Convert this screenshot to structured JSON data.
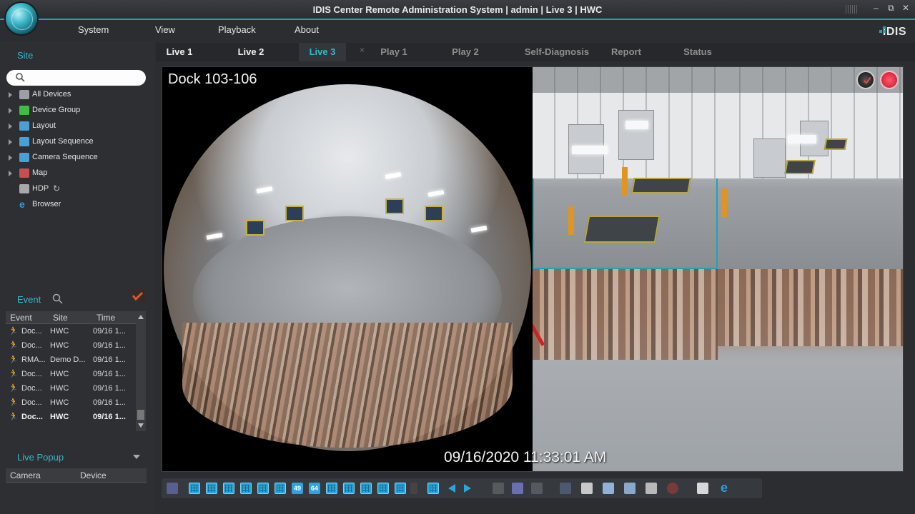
{
  "window": {
    "title": "IDIS Center Remote Administration System | admin | Live 3 | HWC",
    "brand": "IDIS",
    "accent": "#1fa3b5"
  },
  "menu": {
    "items": [
      "System",
      "View",
      "Playback",
      "About"
    ]
  },
  "site": {
    "title": "Site",
    "search_placeholder": "",
    "tree": [
      {
        "label": "All Devices",
        "icon": "all-devices-icon",
        "color": "#9aa0a6"
      },
      {
        "label": "Device Group",
        "icon": "device-group-icon",
        "color": "#3fbf3f"
      },
      {
        "label": "Layout",
        "icon": "layout-icon",
        "color": "#4a9fd6"
      },
      {
        "label": "Layout Sequence",
        "icon": "layout-sequence-icon",
        "color": "#4a9fd6"
      },
      {
        "label": "Camera Sequence",
        "icon": "camera-sequence-icon",
        "color": "#4a9fd6"
      },
      {
        "label": "Map",
        "icon": "map-icon",
        "color": "#c65050"
      },
      {
        "label": "HDP",
        "icon": "hdp-icon",
        "color": "#a8a8a8"
      },
      {
        "label": "Browser",
        "icon": "browser-icon",
        "color": "#2a9ee0"
      }
    ]
  },
  "event": {
    "title": "Event",
    "columns": [
      "Event",
      "Site",
      "Time"
    ],
    "rows": [
      {
        "event": "Doc...",
        "site": "HWC",
        "time": "09/16 1..."
      },
      {
        "event": "Doc...",
        "site": "HWC",
        "time": "09/16 1..."
      },
      {
        "event": "RMA...",
        "site": "Demo D...",
        "time": "09/16 1..."
      },
      {
        "event": "Doc...",
        "site": "HWC",
        "time": "09/16 1..."
      },
      {
        "event": "Doc...",
        "site": "HWC",
        "time": "09/16 1..."
      },
      {
        "event": "Doc...",
        "site": "HWC",
        "time": "09/16 1..."
      },
      {
        "event": "Doc...",
        "site": "HWC",
        "time": "09/16 1...",
        "bold": true
      }
    ]
  },
  "live_popup": {
    "title": "Live Popup",
    "columns": [
      "Camera",
      "Device"
    ]
  },
  "tabs": [
    {
      "label": "Live 1",
      "state": "live"
    },
    {
      "label": "Live 2",
      "state": "live"
    },
    {
      "label": "Live 3",
      "state": "active"
    },
    {
      "label": "Play 1",
      "state": "inactive"
    },
    {
      "label": "Play 2",
      "state": "inactive"
    },
    {
      "label": "Self-Diagnosis",
      "state": "inactive"
    },
    {
      "label": "Report",
      "state": "inactive"
    },
    {
      "label": "Status",
      "state": "inactive"
    }
  ],
  "tab_close": "×",
  "video": {
    "camera_title": "Dock 103-106",
    "timestamp": "09/16/2020 11:33:01 AM"
  },
  "toolbar": {
    "layout_numbers": [
      "49",
      "64"
    ]
  }
}
